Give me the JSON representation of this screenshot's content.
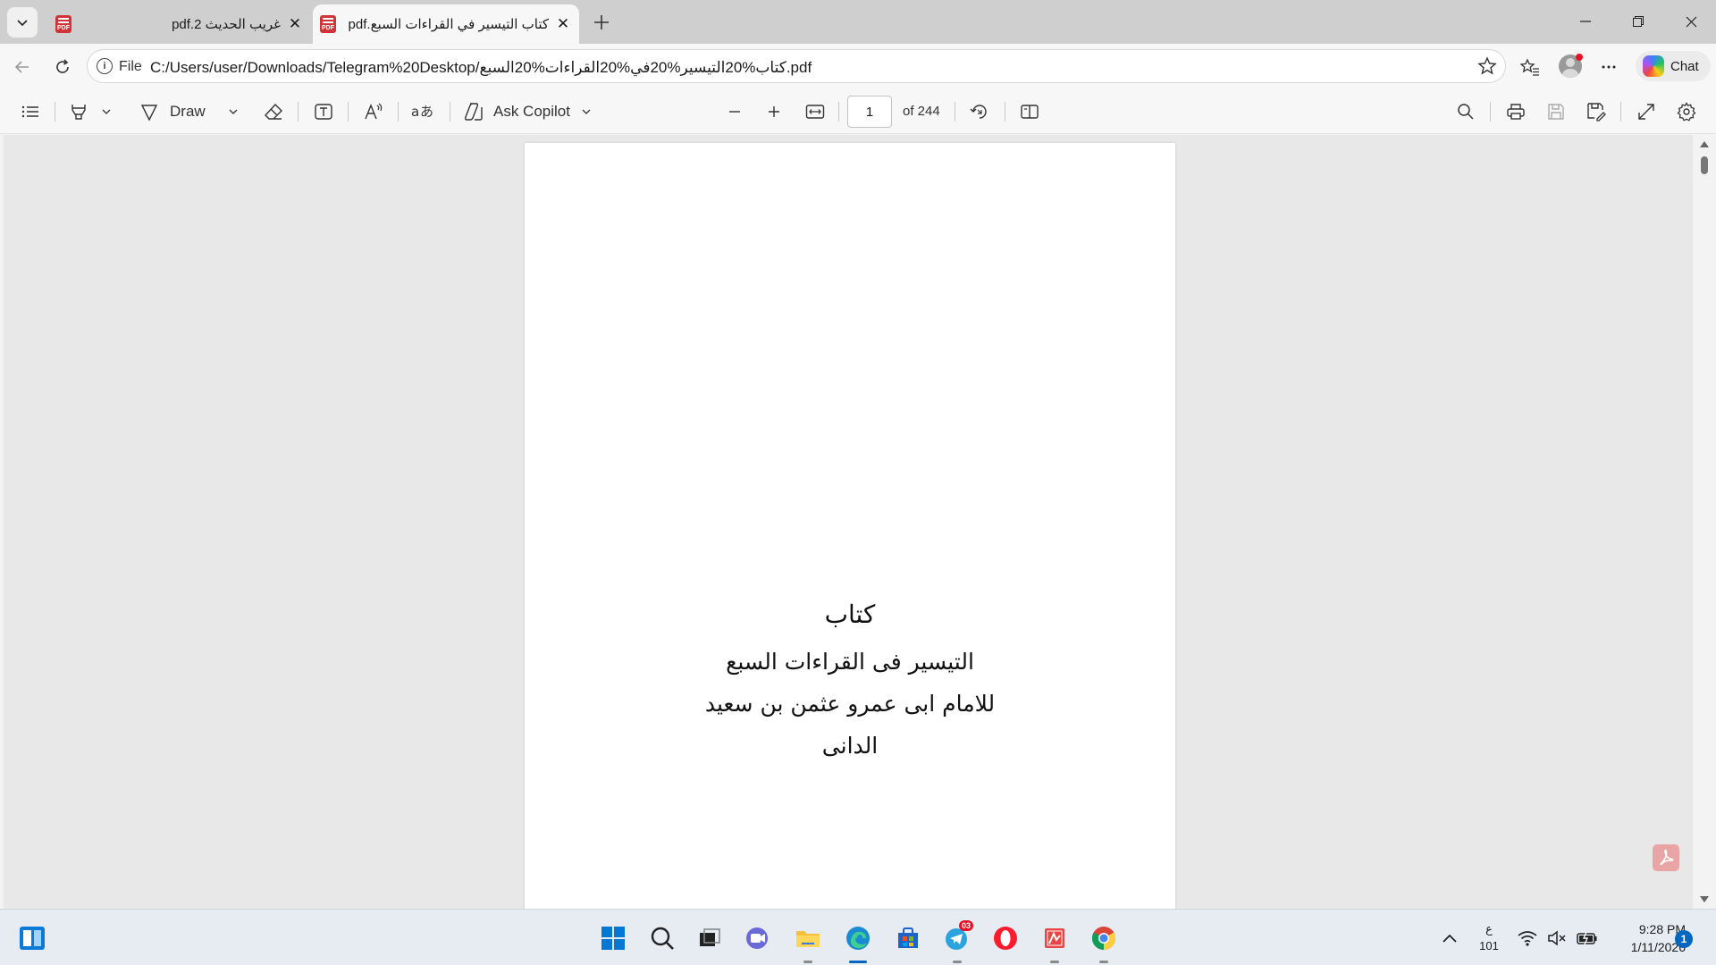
{
  "browser": {
    "tabs": [
      {
        "title": "غريب الحديث 2.pdf",
        "active": false
      },
      {
        "title": "كتاب التيسير في القراءات السبع.pdf",
        "active": true
      }
    ],
    "address": {
      "scheme_label": "File",
      "url": "C:/Users/user/Downloads/Telegram%20Desktop/كتاب%20التيسير%20في%20القراءات%20السبع.pdf"
    },
    "chat_label": "Chat"
  },
  "pdf_toolbar": {
    "draw_label": "Draw",
    "copilot_label": "Ask Copilot",
    "page_current": "1",
    "page_total_label": "of 244"
  },
  "document": {
    "lines": [
      "كتاب",
      "التيسير فى القراءات السبع",
      "للامام ابى عمرو عثمن بن سعيد",
      "الدانى"
    ]
  },
  "taskbar": {
    "lang_top": "ع",
    "lang_bottom": "101",
    "time": "9:28 PM",
    "date": "1/11/2026",
    "notification_count": "1",
    "telegram_badge": "03"
  },
  "colors": {
    "accent": "#0067c0",
    "pdf_icon": "#d13438",
    "tab_strip": "#cfcfcf"
  }
}
